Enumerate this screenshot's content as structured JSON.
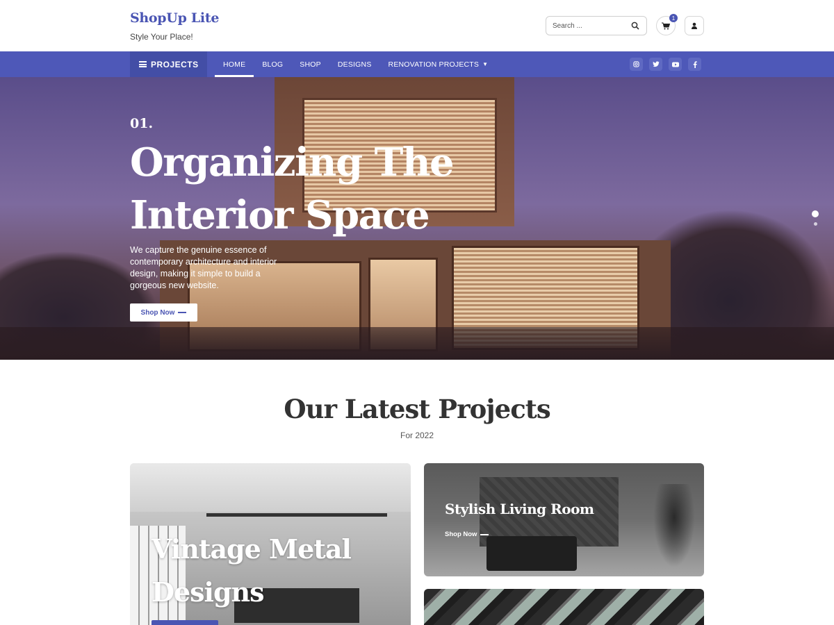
{
  "header": {
    "brand_title": "ShopUp Lite",
    "brand_tagline": "Style Your Place!",
    "search_placeholder": "Search ...",
    "cart_count": "1"
  },
  "nav": {
    "projects_label": "PROJECTS",
    "links": [
      {
        "label": "HOME",
        "active": true
      },
      {
        "label": "BLOG"
      },
      {
        "label": "SHOP"
      },
      {
        "label": "DESIGNS"
      },
      {
        "label": "RENOVATION PROJECTS",
        "has_dropdown": true
      }
    ],
    "socials": [
      "instagram-icon",
      "twitter-icon",
      "youtube-icon",
      "facebook-icon"
    ]
  },
  "hero": {
    "number": "01.",
    "title": "Organizing The Interior Space",
    "description": "We capture the genuine essence of contemporary architecture and interior design, making it simple to build a gorgeous new website.",
    "button_label": "Shop Now",
    "slides": 2,
    "active_slide": 1
  },
  "projects": {
    "title": "Our Latest Projects",
    "subtitle": "For 2022",
    "cards": [
      {
        "title": "Vintage Metal Designs"
      },
      {
        "title": "Stylish Living Room",
        "button_label": "Shop Now"
      }
    ]
  },
  "colors": {
    "accent": "#4e58b8",
    "accent_dark": "#434ea6"
  }
}
